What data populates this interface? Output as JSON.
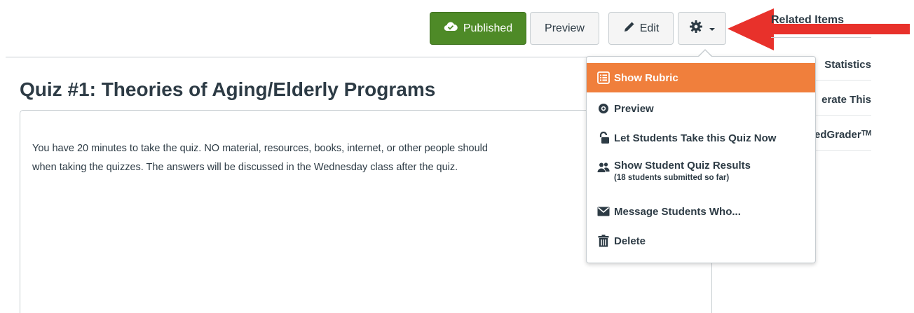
{
  "toolbar": {
    "published_label": "Published",
    "preview_label": "Preview",
    "edit_label": "Edit"
  },
  "sidebar": {
    "title": "Related Items",
    "links": [
      "Statistics",
      "erate This",
      "edGraderᵀᴹ"
    ]
  },
  "quiz": {
    "title": "Quiz #1: Theories of Aging/Elderly Programs",
    "description_line1": "You have 20 minutes to take the quiz.  NO material, resources, books, internet, or other people should",
    "description_line2": "when taking the quizzes.  The answers will be discussed in the Wednesday class after the quiz."
  },
  "menu": {
    "items": [
      {
        "label": "Show Rubric",
        "icon": "rubric-icon"
      },
      {
        "label": "Preview",
        "icon": "preview-icon"
      },
      {
        "label": "Let Students Take this Quiz Now",
        "icon": "unlock-icon"
      },
      {
        "label": "Show Student Quiz Results",
        "sublabel": "(18 students submitted so far)",
        "icon": "users-icon"
      },
      {
        "label": "Message Students Who...",
        "icon": "envelope-icon"
      },
      {
        "label": "Delete",
        "icon": "trash-icon"
      }
    ]
  },
  "colors": {
    "published_green": "#4e8a27",
    "menu_highlight": "#f07f3c",
    "annotation_arrow": "#e8312b"
  }
}
